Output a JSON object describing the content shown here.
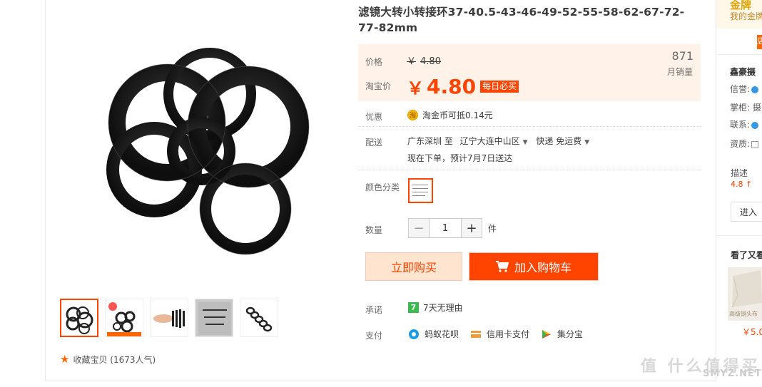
{
  "product": {
    "title": "滤镜大转小转接环37-40.5-43-46-49-52-55-58-62-67-72-77-82mm"
  },
  "price": {
    "label": "价格",
    "original": "4.80",
    "promo_label": "淘宝价",
    "current": "4.80",
    "yen": "￥",
    "daily_badge": "每日必买",
    "monthly_sales": "871",
    "monthly_sales_label": "月销量"
  },
  "benefits": {
    "label": "优惠",
    "coin_icon": "淘",
    "text": "淘金币可抵0.14元"
  },
  "delivery": {
    "label": "配送",
    "from": "广东深圳 至",
    "to": "辽宁大连中山区",
    "method": "快递 免运费",
    "eta": "现在下单，预计7月7日送达"
  },
  "color": {
    "label": "颜色分类"
  },
  "quantity": {
    "label": "数量",
    "minus": "−",
    "value": "1",
    "plus": "+",
    "unit": "件"
  },
  "actions": {
    "buy_now": "立即购买",
    "add_to_cart": "加入购物车"
  },
  "promise": {
    "label": "承诺",
    "icon_text": "7",
    "text": "7天无理由"
  },
  "payment": {
    "label": "支付",
    "methods": [
      "蚂蚁花呗",
      "信用卡支付",
      "集分宝"
    ]
  },
  "favorite": {
    "text": "收藏宝贝 (1673人气)"
  },
  "sidebar": {
    "gold_title": "金牌",
    "gold_sub": "我的金牌",
    "tab": "店",
    "shop_name": "鑫豪摄",
    "rows": [
      "信誉:",
      "掌柜: 摄",
      "联系:",
      "资质:"
    ],
    "desc_label": "描述",
    "desc_value": "4.8 ↑",
    "enter_shop": "进入",
    "see_also": "看了又看",
    "see_price": "￥5.0",
    "see_caption": "高级镜头布"
  },
  "watermark": {
    "text": "值 什么值得买",
    "sub": "SMYZ.NET"
  },
  "colors": {
    "accent": "#ff4400",
    "price_bg": "#fff2e8",
    "buy_bg": "#ffe4d0"
  }
}
